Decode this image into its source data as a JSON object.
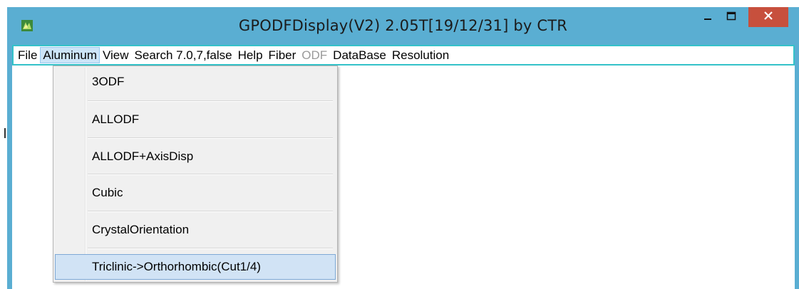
{
  "window": {
    "title": "GPODFDisplay(V2) 2.05T[19/12/31] by CTR",
    "colors": {
      "titlebar": "#5aaed2",
      "close_button": "#c7503d",
      "menubar_border": "#34c2c9",
      "menu_active_bg": "#cce4f7",
      "menu_hover_bg": "#d1e3f5"
    },
    "controls": {
      "minimize_icon": "minimize-icon",
      "maximize_icon": "maximize-icon",
      "close_icon": "close-icon"
    }
  },
  "menubar": {
    "items": [
      {
        "label": "File",
        "state": "normal"
      },
      {
        "label": "Aluminum",
        "state": "active"
      },
      {
        "label": "View",
        "state": "normal"
      },
      {
        "label": "Search 7.0,7,false",
        "state": "normal"
      },
      {
        "label": "Help",
        "state": "normal"
      },
      {
        "label": "Fiber",
        "state": "normal"
      },
      {
        "label": "ODF",
        "state": "disabled"
      },
      {
        "label": "DataBase",
        "state": "normal"
      },
      {
        "label": "Resolution",
        "state": "normal"
      }
    ]
  },
  "dropdown": {
    "parent": "Aluminum",
    "items": [
      {
        "label": "3ODF"
      },
      {
        "label": "ALLODF"
      },
      {
        "label": "ALLODF+AxisDisp"
      },
      {
        "label": "Cubic"
      },
      {
        "label": "CrystalOrientation"
      },
      {
        "label": "Triclinic->Orthorhombic(Cut1/4)",
        "highlighted": true
      }
    ]
  }
}
